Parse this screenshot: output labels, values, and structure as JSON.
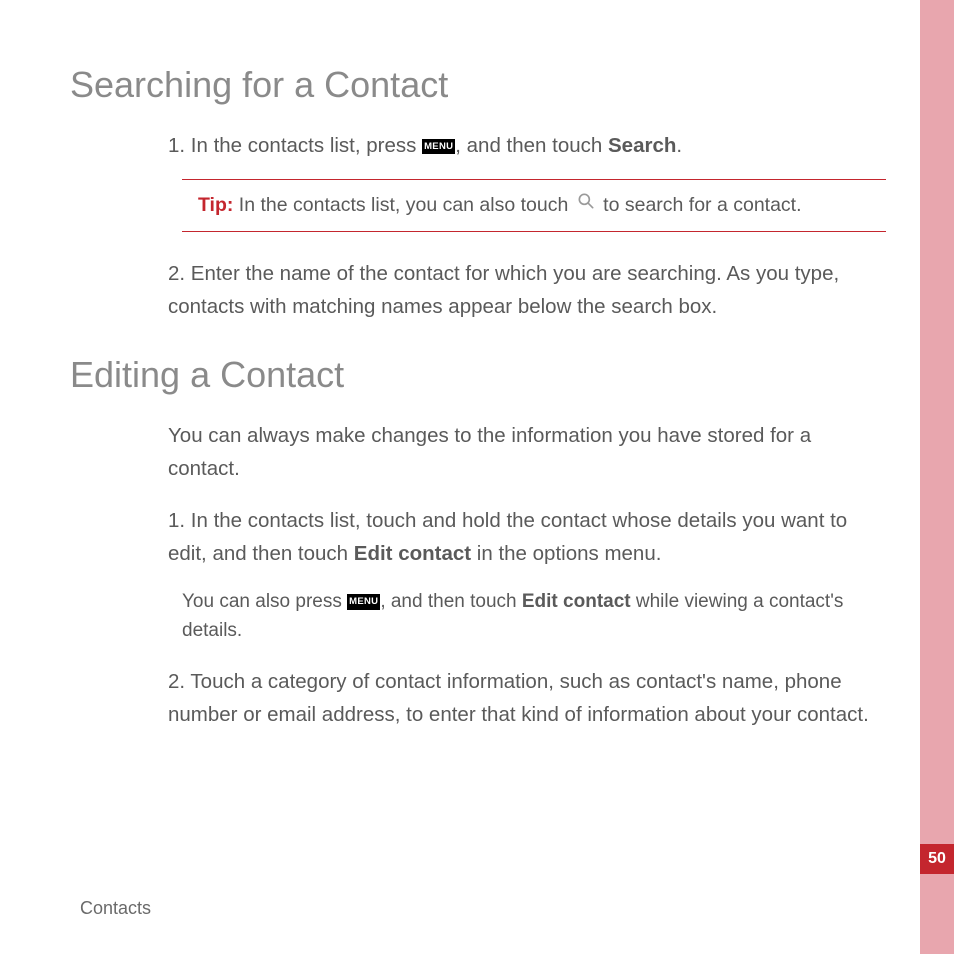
{
  "section1": {
    "heading": "Searching for a Contact",
    "step1_a": "1. In the contacts list, press ",
    "menu_label": "MENU",
    "step1_b": ", and then touch ",
    "step1_bold": "Search",
    "step1_c": ".",
    "tip_label": "Tip:",
    "tip_a": "  In the contacts list, you can also touch ",
    "tip_b": " to search for a contact.",
    "step2": "2. Enter the name of the contact for which you are searching. As you type, contacts with matching names appear below the search box."
  },
  "section2": {
    "heading": "Editing a Contact",
    "intro": "You can always make changes to the information you have stored for a contact.",
    "step1_a": "1. In the contacts list, touch and hold the contact whose details you want to edit, and then touch ",
    "step1_bold": "Edit contact",
    "step1_b": " in the options menu.",
    "note_a": "You can also press ",
    "note_b": ", and then touch ",
    "note_bold": "Edit contact",
    "note_c": " while viewing a contact's details.",
    "step2": "2. Touch a category of contact information, such as contact's name, phone number or email address, to enter that kind of information about your contact."
  },
  "footer": {
    "label": "Contacts",
    "page_number": "50"
  }
}
